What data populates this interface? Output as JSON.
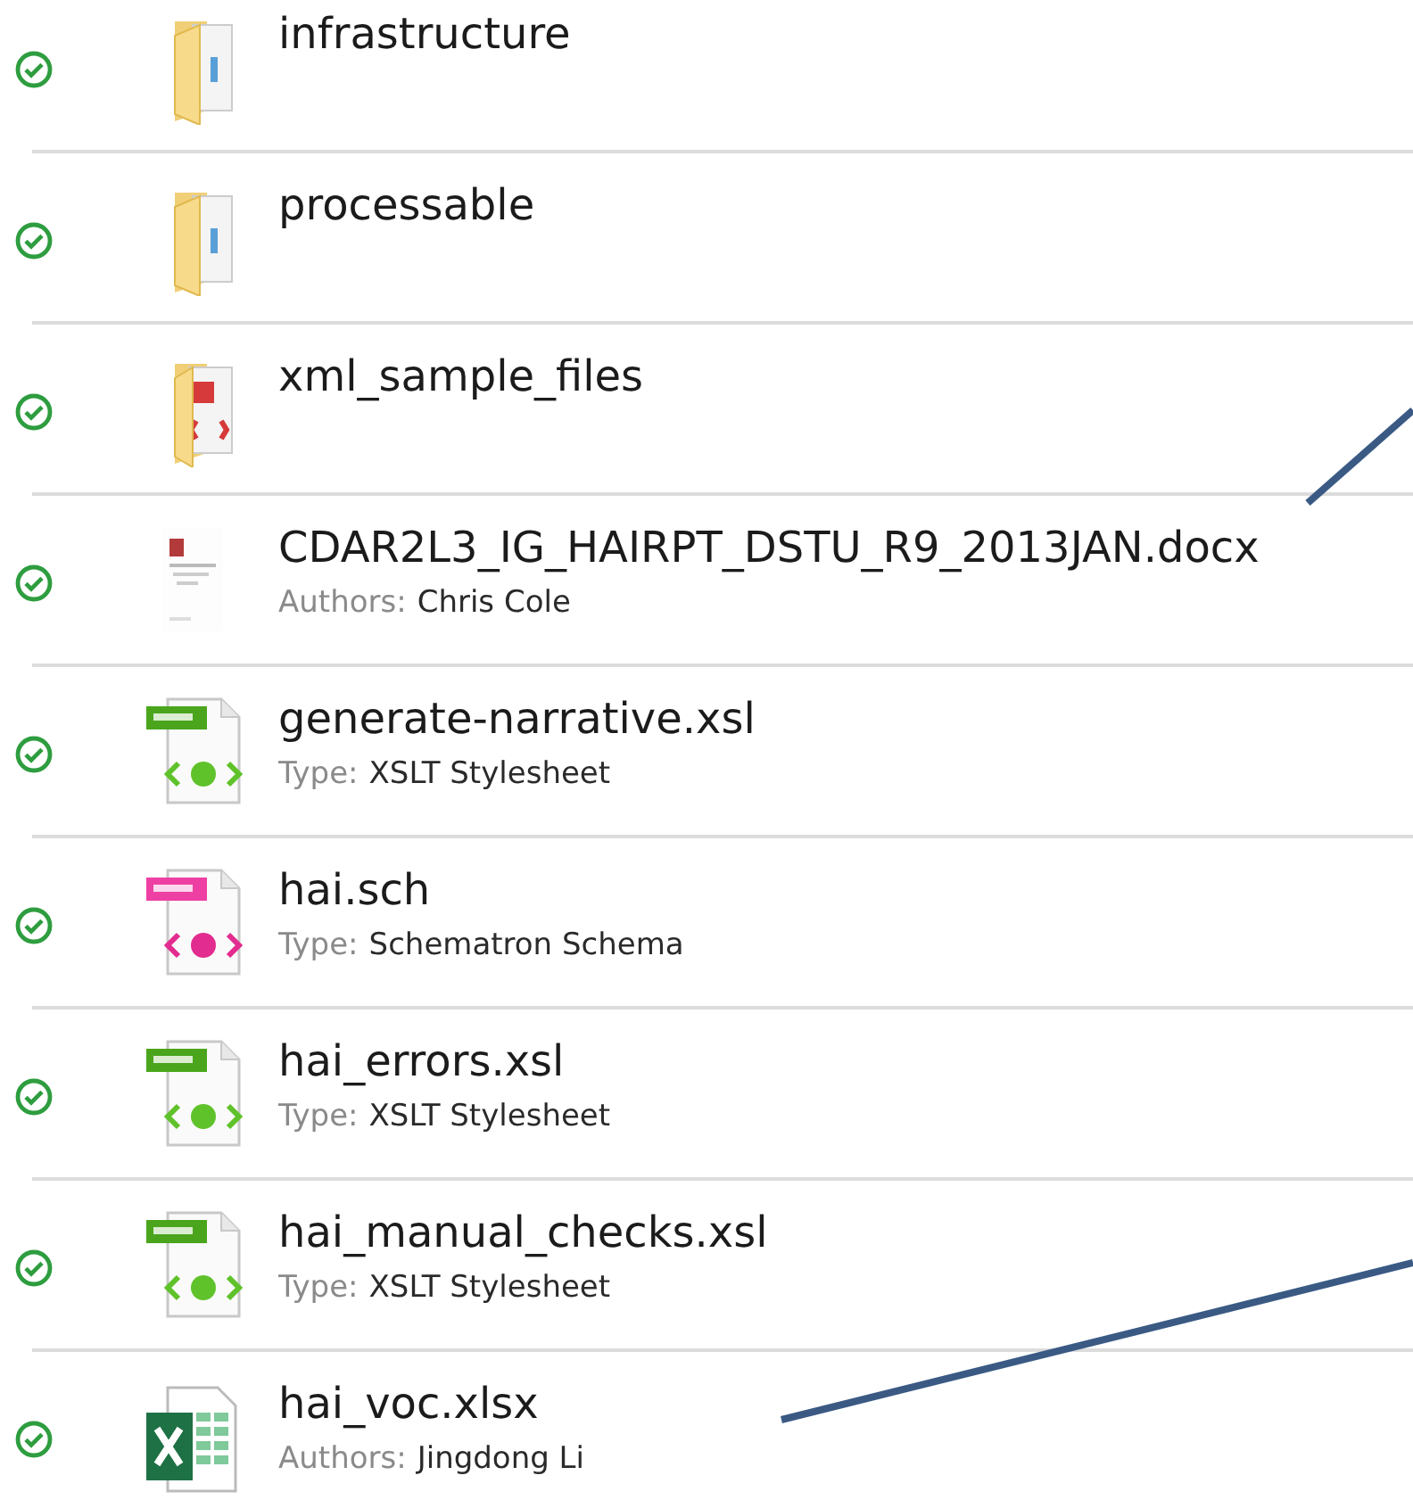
{
  "files": [
    {
      "name": "infrastructure",
      "kind": "folder",
      "synced": true
    },
    {
      "name": "processable",
      "kind": "folder",
      "synced": true
    },
    {
      "name": "xml_sample_files",
      "kind": "folderfiles",
      "synced": true
    },
    {
      "name": "CDAR2L3_IG_HAIRPT_DSTU_R9_2013JAN.docx",
      "kind": "document",
      "synced": true,
      "meta": {
        "label": "Authors:",
        "value": "Chris Cole"
      }
    },
    {
      "name": "generate-narrative.xsl",
      "kind": "xsl",
      "synced": true,
      "meta": {
        "label": "Type:",
        "value": "XSLT Stylesheet"
      }
    },
    {
      "name": "hai.sch",
      "kind": "sch",
      "synced": true,
      "meta": {
        "label": "Type:",
        "value": "Schematron Schema"
      }
    },
    {
      "name": "hai_errors.xsl",
      "kind": "xsl",
      "synced": true,
      "meta": {
        "label": "Type:",
        "value": "XSLT Stylesheet"
      }
    },
    {
      "name": "hai_manual_checks.xsl",
      "kind": "xsl",
      "synced": true,
      "meta": {
        "label": "Type:",
        "value": "XSLT Stylesheet"
      }
    },
    {
      "name": "hai_voc.xlsx",
      "kind": "spreadsheet",
      "synced": true,
      "meta": {
        "label": "Authors:",
        "value": "Jingdong Li"
      }
    }
  ]
}
